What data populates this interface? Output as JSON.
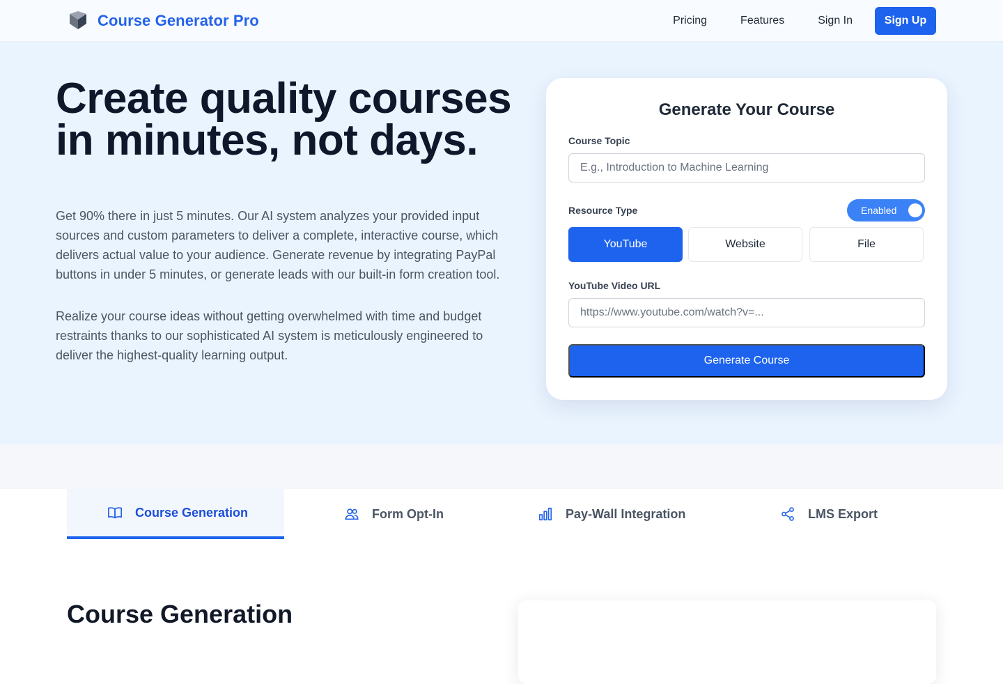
{
  "header": {
    "brand": "Course Generator Pro",
    "nav": [
      "Pricing",
      "Features",
      "Sign In"
    ],
    "signup_label": "Sign Up"
  },
  "hero": {
    "title_line1": "Create quality courses",
    "title_line2": "in minutes, not days.",
    "paragraph1": "Get 90% there in just 5 minutes. Our AI system analyzes your provided input sources and custom parameters to deliver a complete, interactive course, which delivers actual value to your audience. Generate revenue by integrating PayPal buttons in under 5 minutes, or generate leads with our built-in form creation tool.",
    "paragraph2": "Realize your course ideas without getting overwhelmed with time and budget restraints thanks to our sophisticated AI system is meticulously engineered to deliver the highest-quality learning output."
  },
  "form": {
    "title": "Generate Your Course",
    "topic_label": "Course Topic",
    "topic_placeholder": "E.g., Introduction to Machine Learning",
    "topic_value": "",
    "resource_label": "Resource Type",
    "toggle_label": "Enabled",
    "toggle_on": true,
    "resource_options": [
      "YouTube",
      "Website",
      "File"
    ],
    "selected_resource": "YouTube",
    "url_label": "YouTube Video URL",
    "url_placeholder": "https://www.youtube.com/watch?v=...",
    "url_value": "",
    "submit_label": "Generate Course"
  },
  "tabs": [
    {
      "label": "Course Generation",
      "icon": "book-open-icon",
      "active": true
    },
    {
      "label": "Form Opt-In",
      "icon": "users-icon",
      "active": false
    },
    {
      "label": "Pay-Wall Integration",
      "icon": "bar-chart-icon",
      "active": false
    },
    {
      "label": "LMS Export",
      "icon": "share-icon",
      "active": false
    }
  ],
  "section": {
    "title": "Course Generation"
  },
  "colors": {
    "accent": "#1d63ed",
    "brand_text": "#2563eb",
    "hero_bg": "#eaf4ff"
  }
}
